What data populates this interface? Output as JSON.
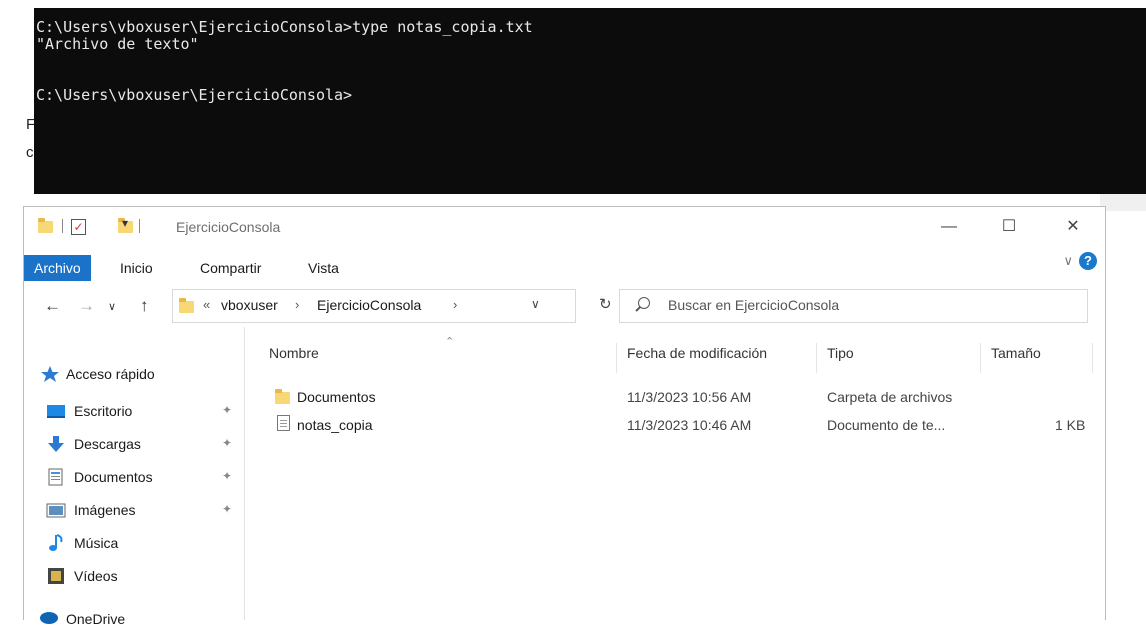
{
  "console": {
    "lines": [
      "C:\\Users\\vboxuser\\EjercicioConsola>type notas_copia.txt",
      "\"Archivo de texto\"",
      "",
      "C:\\Users\\vboxuser\\EjercicioConsola>"
    ],
    "background_color": "#0c0c0c",
    "text_color": "#e8e8e8"
  },
  "background_fragments": [
    "F",
    "c"
  ],
  "explorer": {
    "title": "EjercicioConsola",
    "window_controls": {
      "minimize": "—",
      "maximize": "☐",
      "close": "✕"
    },
    "ribbon_tabs": [
      {
        "label": "Archivo",
        "active": true
      },
      {
        "label": "Inicio",
        "active": false
      },
      {
        "label": "Compartir",
        "active": false
      },
      {
        "label": "Vista",
        "active": false
      }
    ],
    "help": "?",
    "address": {
      "prefix": "«",
      "crumbs": [
        "vboxuser",
        "EjercicioConsola"
      ],
      "separator": "›"
    },
    "search": {
      "placeholder": "Buscar en EjercicioConsola"
    },
    "sidebar": {
      "items": [
        {
          "label": "Acceso rápido",
          "icon": "star-icon",
          "pinned": false
        },
        {
          "label": "Escritorio",
          "icon": "desktop-icon",
          "pinned": true
        },
        {
          "label": "Descargas",
          "icon": "download-icon",
          "pinned": true
        },
        {
          "label": "Documentos",
          "icon": "documents-icon",
          "pinned": true
        },
        {
          "label": "Imágenes",
          "icon": "pictures-icon",
          "pinned": true
        },
        {
          "label": "Música",
          "icon": "music-icon",
          "pinned": false
        },
        {
          "label": "Vídeos",
          "icon": "videos-icon",
          "pinned": false
        },
        {
          "label": "OneDrive",
          "icon": "onedrive-icon",
          "pinned": false
        }
      ]
    },
    "columns": [
      "Nombre",
      "Fecha de modificación",
      "Tipo",
      "Tamaño"
    ],
    "files": [
      {
        "name": "Documentos",
        "icon": "folder-icon",
        "modified": "11/3/2023 10:56 AM",
        "type": "Carpeta de archivos",
        "size": ""
      },
      {
        "name": "notas_copia",
        "icon": "text-file-icon",
        "modified": "11/3/2023 10:46 AM",
        "type": "Documento de te...",
        "size": "1 KB"
      }
    ],
    "accent_color": "#1a73c8"
  }
}
